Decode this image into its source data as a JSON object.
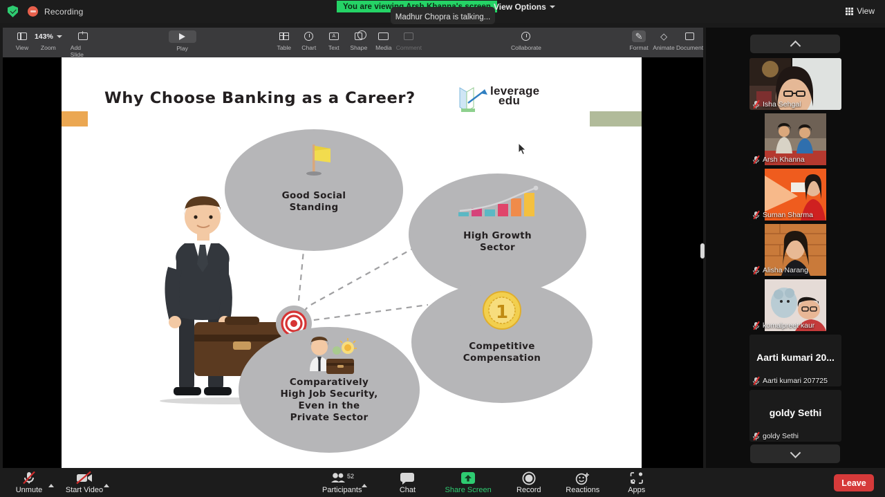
{
  "topbar": {
    "recording_label": "Recording",
    "shield_icon": "security-shield-icon",
    "view_banner": "You are viewing Arsh Khanna's screen",
    "view_options": "View Options",
    "talking_status": "Madhur Chopra is talking...",
    "view_button": "View"
  },
  "keynote_toolbar": {
    "view": "View",
    "zoom_label": "Zoom",
    "zoom_value": "143%",
    "add_slide": "Add Slide",
    "play": "Play",
    "table": "Table",
    "chart": "Chart",
    "text": "Text",
    "shape": "Shape",
    "media": "Media",
    "comment": "Comment",
    "collaborate": "Collaborate",
    "format": "Format",
    "animate": "Animate",
    "document": "Document"
  },
  "slide": {
    "title": "Why Choose Banking as a Career?",
    "logo_line1": "leverage",
    "logo_line2": "edu",
    "accent_orange": "#eba752",
    "accent_green": "#b1bb9a",
    "bubble_fill": "#b6b6b8",
    "nodes": [
      {
        "id": "good-social-standing",
        "line1": "Good Social",
        "line2": "Standing",
        "icon": "flag-icon"
      },
      {
        "id": "high-growth-sector",
        "line1": "High Growth",
        "line2": "Sector",
        "icon": "bar-chart-icon"
      },
      {
        "id": "competitive-compensation",
        "line1": "Competitive",
        "line2": "Compensation",
        "icon": "gold-medal-icon"
      },
      {
        "id": "high-job-security",
        "line1": "Comparatively",
        "line2": "High Job Security,",
        "line3": "Even in the",
        "line4": "Private Sector",
        "icon": "businessman-idea-icon"
      }
    ],
    "hub_icon": "target-icon"
  },
  "participants": {
    "scroll_up": "scroll-up",
    "scroll_down": "scroll-down",
    "tiles": [
      {
        "name": "Isha Sehgal",
        "muted": true,
        "type": "video"
      },
      {
        "name": "Arsh Khanna",
        "muted": true,
        "type": "video"
      },
      {
        "name": "Suman Sharma",
        "muted": true,
        "type": "video"
      },
      {
        "name": "Alisha Narang",
        "muted": true,
        "type": "video"
      },
      {
        "name": "komalpreet kaur",
        "muted": true,
        "type": "video"
      },
      {
        "name": "Aarti kumari 207725",
        "display": "Aarti  kumari  20...",
        "muted": true,
        "type": "name"
      },
      {
        "name": "goldy Sethi",
        "display": "goldy Sethi",
        "muted": true,
        "type": "name"
      }
    ]
  },
  "bottombar": {
    "unmute": "Unmute",
    "start_video": "Start Video",
    "participants": "Participants",
    "participants_count": "52",
    "chat": "Chat",
    "share_screen": "Share Screen",
    "record": "Record",
    "reactions": "Reactions",
    "apps": "Apps",
    "leave": "Leave",
    "share_color": "#2ecc71",
    "leave_color": "#d63a3a"
  }
}
